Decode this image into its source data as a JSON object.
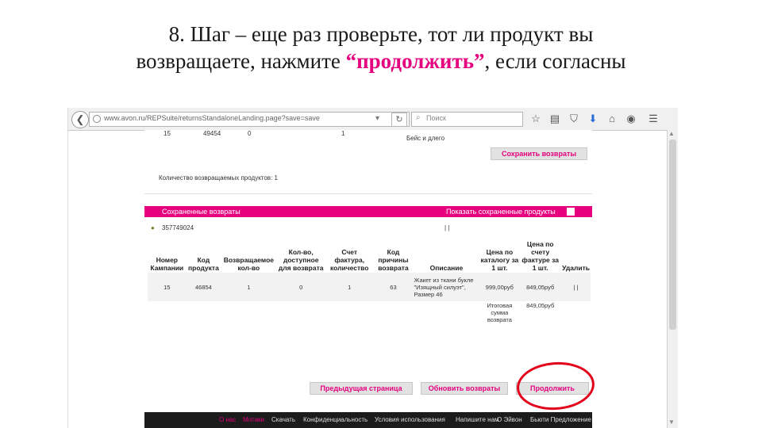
{
  "slide": {
    "title_line1": "8. Шаг – еще раз проверьте, тот ли продукт вы",
    "title_line2_pre": "возвращаете, нажмите ",
    "title_line2_highlight": "“продолжить”",
    "title_line2_post": ", если согласны"
  },
  "browser": {
    "url": "www.avon.ru/REPSuite/returnsStandaloneLanding.page?save=save",
    "search_placeholder": "Поиск",
    "back_glyph": "❮",
    "reload_glyph": "↻",
    "dropdown_glyph": "▾",
    "icons": [
      "star-icon",
      "reading-list-icon",
      "pocket-icon",
      "download-icon",
      "home-icon",
      "chat-icon",
      "menu-icon"
    ]
  },
  "page": {
    "top_row_values": [
      "15",
      "49454",
      "0",
      "1"
    ],
    "top_row_desc": "Бейс и длего",
    "save_returns_label": "Сохранить возвраты",
    "returned_count_text": "Количество возвращаемых продуктов: 1",
    "saved_returns_header": "Сохраненные возвраты",
    "show_saved_label": "Показать сохраненные продукты",
    "order_number": "357749024",
    "order_marks": "| |",
    "table": {
      "headers": [
        "Номер Кампании",
        "Код продукта",
        "Возвращаемое кол-во",
        "Кол-во, доступное для возврата",
        "Счет фактура, количество",
        "Код причины возврата",
        "Описание",
        "Цена по каталогу за 1 шт.",
        "Цена по счету фактуре за 1 шт.",
        "Удалить"
      ],
      "rows": [
        [
          "15",
          "46854",
          "1",
          "0",
          "1",
          "63",
          "Жакет из ткани букле \"Изящный силуэт\", Размер 46",
          "999,00руб",
          "849,05руб",
          "| |"
        ]
      ],
      "total_label": "Итоговая сумма возврата",
      "total_value": "849,05руб"
    },
    "prev_page_label": "Предыдущая страница",
    "update_returns_label": "Обновить возвраты",
    "continue_label": "Продолжить",
    "footer_links": [
      "О нас",
      "Мотаки",
      "Скачать",
      "Конфиденциальность",
      "Условия использования",
      "Напишите нам",
      "О Эйвон",
      "Бьюти Предложение"
    ]
  },
  "colors": {
    "accent": "#e6007e",
    "annotation": "#e3001b"
  }
}
